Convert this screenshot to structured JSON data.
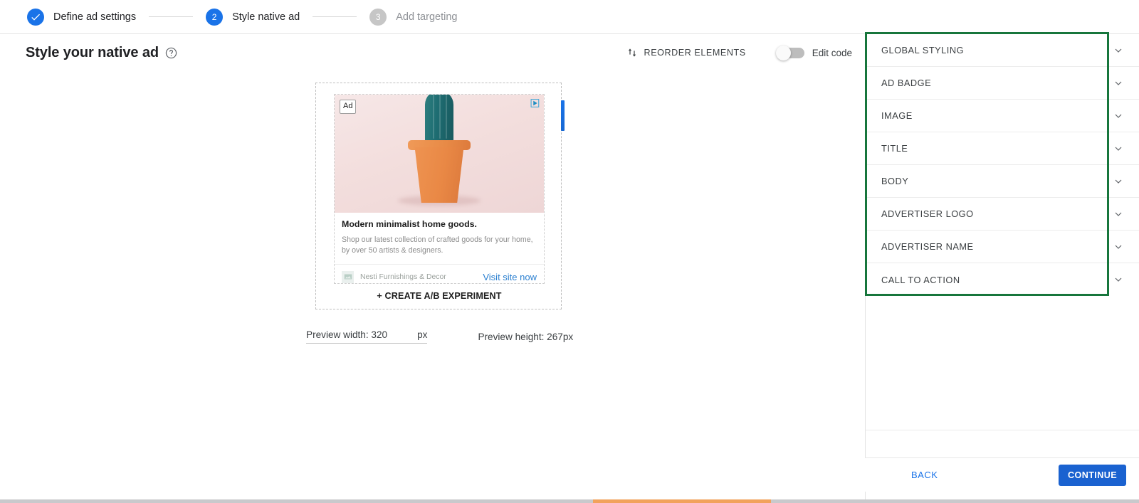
{
  "stepper": {
    "steps": [
      {
        "num": "1",
        "label": "Define ad settings",
        "state": "done",
        "icon": "check-icon"
      },
      {
        "num": "2",
        "label": "Style native ad",
        "state": "active"
      },
      {
        "num": "3",
        "label": "Add targeting",
        "state": "todo"
      }
    ]
  },
  "header": {
    "title": "Style your native ad",
    "help_icon": "help-circle-icon",
    "reorder_label": "REORDER ELEMENTS",
    "reorder_icon": "sort-arrows-icon",
    "edit_code_label": "Edit code",
    "edit_code_on": false
  },
  "preview": {
    "ad": {
      "badge": "Ad",
      "adchoices_icon": "adchoices-icon",
      "image_alt": "cactus-in-orange-pot",
      "title": "Modern minimalist home goods.",
      "body": "Shop our latest collection of crafted goods for your home, by over 50 artists & designers.",
      "advertiser_logo_icon": "image-placeholder-icon",
      "advertiser_name": "Nesti Furnishings & Decor",
      "cta": "Visit site now"
    },
    "ab_experiment_label": "+ CREATE A/B EXPERIMENT",
    "width_label": "Preview width: 320",
    "width_unit": "px",
    "height_label": "Preview height: 267px"
  },
  "panel": {
    "sections": [
      {
        "label": "GLOBAL STYLING",
        "chevron": "chevron-down-icon"
      },
      {
        "label": "AD BADGE",
        "chevron": "chevron-down-icon"
      },
      {
        "label": "IMAGE",
        "chevron": "chevron-down-icon"
      },
      {
        "label": "TITLE",
        "chevron": "chevron-down-icon"
      },
      {
        "label": "BODY",
        "chevron": "chevron-down-icon"
      },
      {
        "label": "ADVERTISER LOGO",
        "chevron": "chevron-down-icon"
      },
      {
        "label": "ADVERTISER NAME",
        "chevron": "chevron-down-icon"
      },
      {
        "label": "CALL TO ACTION",
        "chevron": "chevron-down-icon"
      }
    ],
    "highlight_color": "#17763c"
  },
  "footer": {
    "back_label": "BACK",
    "continue_label": "CONTINUE",
    "continue_color": "#1a62d0"
  },
  "colors": {
    "accent_blue": "#1a73e8",
    "muted_grey": "#8e9196",
    "cta_blue": "#2a7fd0"
  }
}
